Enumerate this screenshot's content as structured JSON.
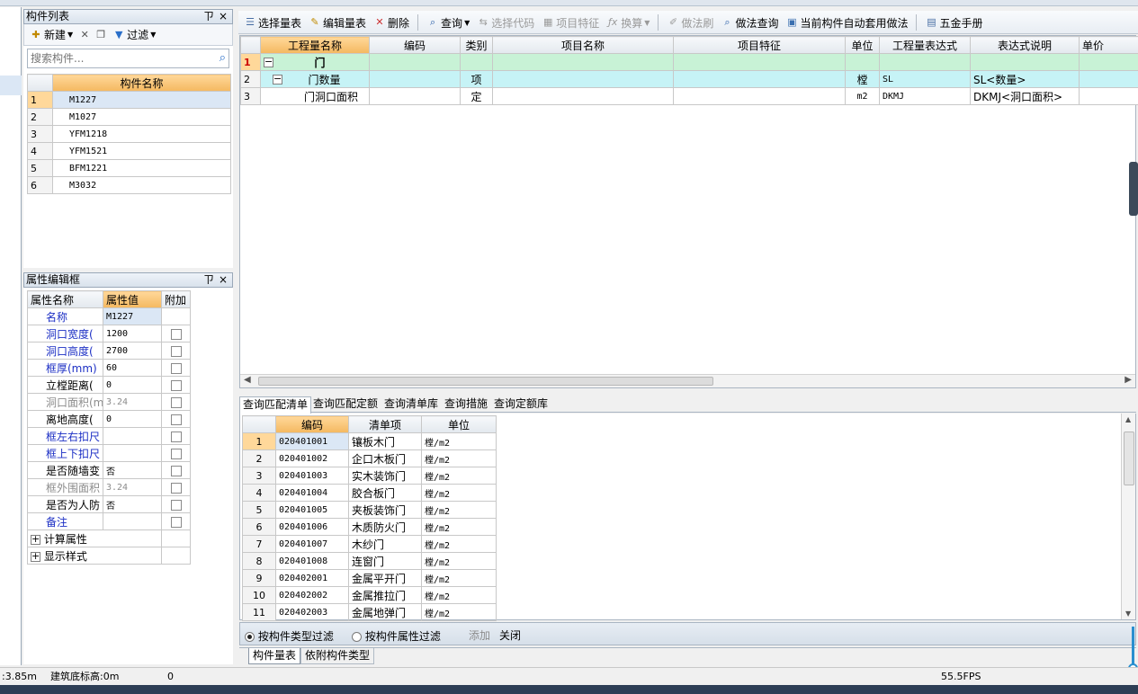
{
  "component_list": {
    "title": "构件列表",
    "pin": "ㄗ",
    "close": "×",
    "toolbar": {
      "new": "新建",
      "filter": "过滤"
    },
    "search_placeholder": "搜索构件...",
    "column": "构件名称",
    "rows": [
      {
        "n": "1",
        "name": "M1227"
      },
      {
        "n": "2",
        "name": "M1027"
      },
      {
        "n": "3",
        "name": "YFM1218"
      },
      {
        "n": "4",
        "name": "YFM1521"
      },
      {
        "n": "5",
        "name": "BFM1221"
      },
      {
        "n": "6",
        "name": "M3032"
      }
    ]
  },
  "property_box": {
    "title": "属性编辑框",
    "pin": "ㄗ",
    "close": "×",
    "columns": [
      "属性名称",
      "属性值",
      "附加"
    ],
    "rows": [
      {
        "name": "名称",
        "value": "M1227"
      },
      {
        "name": "洞口宽度(",
        "value": "1200"
      },
      {
        "name": "洞口高度(",
        "value": "2700"
      },
      {
        "name": "框厚(mm)",
        "value": "60"
      },
      {
        "name": "立樘距离(",
        "value": "0"
      },
      {
        "name": "洞口面积(m",
        "value": "3.24"
      },
      {
        "name": "离地高度(",
        "value": "0"
      },
      {
        "name": "框左右扣尺",
        "value": ""
      },
      {
        "name": "框上下扣尺",
        "value": ""
      },
      {
        "name": "是否随墙变",
        "value": "否"
      },
      {
        "name": "框外围面积",
        "value": "3.24"
      },
      {
        "name": "是否为人防",
        "value": "否"
      },
      {
        "name": "备注",
        "value": ""
      }
    ],
    "groups": [
      "计算属性",
      "显示样式"
    ]
  },
  "toolbar": {
    "select_qty": "选择量表",
    "edit_qty": "编辑量表",
    "delete": "删除",
    "query": "查询",
    "select_code": "选择代码",
    "item_feature": "项目特征",
    "convert": "换算",
    "method_brush": "做法刷",
    "method_query": "做法查询",
    "auto_apply": "当前构件自动套用做法",
    "hardware": "五金手册"
  },
  "qty_table": {
    "columns": [
      "工程量名称",
      "编码",
      "类别",
      "项目名称",
      "项目特征",
      "单位",
      "工程量表达式",
      "表达式说明",
      "单价"
    ],
    "rows": [
      {
        "n": "1",
        "name": "门",
        "code": "",
        "type": "",
        "pname": "",
        "feat": "",
        "unit": "",
        "expr": "",
        "desc": ""
      },
      {
        "n": "2",
        "name": "门数量",
        "code": "",
        "type": "项",
        "pname": "",
        "feat": "",
        "unit": "樘",
        "expr": "SL",
        "desc": "SL<数量>"
      },
      {
        "n": "3",
        "name": "门洞口面积",
        "code": "",
        "type": "定",
        "pname": "",
        "feat": "",
        "unit": "m2",
        "expr": "DKMJ",
        "desc": "DKMJ<洞口面积>"
      }
    ]
  },
  "query_tabs": [
    "查询匹配清单",
    "查询匹配定额",
    "查询清单库",
    "查询措施",
    "查询定额库"
  ],
  "match_table": {
    "columns": [
      "编码",
      "清单项",
      "单位"
    ],
    "rows": [
      {
        "n": "1",
        "code": "020401001",
        "item": "镶板木门",
        "unit": "樘/m2"
      },
      {
        "n": "2",
        "code": "020401002",
        "item": "企口木板门",
        "unit": "樘/m2"
      },
      {
        "n": "3",
        "code": "020401003",
        "item": "实木装饰门",
        "unit": "樘/m2"
      },
      {
        "n": "4",
        "code": "020401004",
        "item": "胶合板门",
        "unit": "樘/m2"
      },
      {
        "n": "5",
        "code": "020401005",
        "item": "夹板装饰门",
        "unit": "樘/m2"
      },
      {
        "n": "6",
        "code": "020401006",
        "item": "木质防火门",
        "unit": "樘/m2"
      },
      {
        "n": "7",
        "code": "020401007",
        "item": "木纱门",
        "unit": "樘/m2"
      },
      {
        "n": "8",
        "code": "020401008",
        "item": "连窗门",
        "unit": "樘/m2"
      },
      {
        "n": "9",
        "code": "020402001",
        "item": "金属平开门",
        "unit": "樘/m2"
      },
      {
        "n": "10",
        "code": "020402002",
        "item": "金属推拉门",
        "unit": "樘/m2"
      },
      {
        "n": "11",
        "code": "020402003",
        "item": "金属地弹门",
        "unit": "樘/m2"
      }
    ]
  },
  "filter_bar": {
    "by_type": "按构件类型过滤",
    "by_attr": "按构件属性过滤",
    "add": "添加",
    "close": "关闭"
  },
  "bottom_tabs": [
    "构件量表",
    "依附构件类型"
  ],
  "status": {
    "left": ":3.85m",
    "elevation": "建筑底标高:0m",
    "zero": "0",
    "fps": "55.5FPS"
  },
  "colors": {
    "accent_orange": "#f4b860",
    "row_green": "#c8f2d6",
    "row_cyan": "#c6f3f6",
    "selected_blue": "#dbe7f5"
  }
}
